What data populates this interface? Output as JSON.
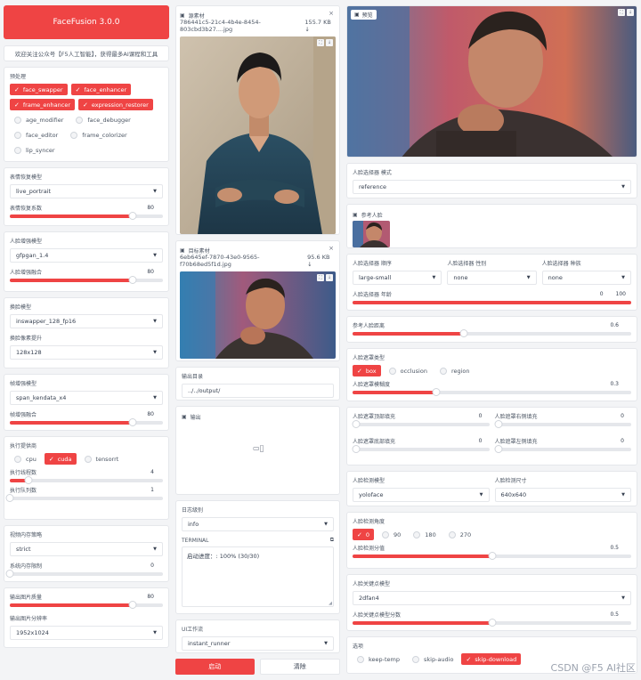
{
  "app_title": "FaceFusion 3.0.0",
  "promo": "欢迎关注公众号【F5人工智能】，获得最多AI课程和工具",
  "processors": {
    "label": "预处理",
    "items": [
      {
        "label": "face_swapper",
        "on": true
      },
      {
        "label": "face_enhancer",
        "on": true
      },
      {
        "label": "frame_enhancer",
        "on": true
      },
      {
        "label": "expression_restorer",
        "on": true
      },
      {
        "label": "age_modifier",
        "on": false
      },
      {
        "label": "face_debugger",
        "on": false
      },
      {
        "label": "face_editor",
        "on": false
      },
      {
        "label": "frame_colorizer",
        "on": false
      },
      {
        "label": "lip_syncer",
        "on": false
      }
    ]
  },
  "expression": {
    "model_label": "表情恢复模型",
    "model_value": "live_portrait",
    "factor_label": "表情恢复系数",
    "factor_value": "80",
    "factor_level": 0.8
  },
  "face_enhancer": {
    "model_label": "人脸增强模型",
    "model_value": "gfpgan_1.4",
    "blend_label": "人脸增强融合",
    "blend_value": "80",
    "blend_level": 0.8
  },
  "face_swapper": {
    "model_label": "换脸模型",
    "model_value": "inswapper_128_fp16",
    "pixel_label": "换脸像素提升",
    "pixel_value": "128x128"
  },
  "frame_enhancer": {
    "model_label": "帧增强模型",
    "model_value": "span_kendata_x4",
    "blend_label": "帧增强融合",
    "blend_value": "80",
    "blend_level": 0.8
  },
  "execution": {
    "providers_label": "执行提供商",
    "providers": [
      {
        "label": "cpu",
        "on": false
      },
      {
        "label": "cuda",
        "on": true
      },
      {
        "label": "tensorrt",
        "on": false
      }
    ],
    "threads_label": "执行线程数",
    "threads_value": "4",
    "threads_level": 0.12,
    "queue_label": "执行队列数",
    "queue_value": "1",
    "queue_level": 0.0
  },
  "memory": {
    "strategy_label": "视频内存策略",
    "strategy_value": "strict",
    "limit_label": "系统内存限制",
    "limit_value": "0",
    "limit_level": 0.0
  },
  "output_image": {
    "quality_label": "输出图片质量",
    "quality_value": "80",
    "quality_level": 0.8,
    "res_label": "输出图片分辨率",
    "res_value": "1952x1024"
  },
  "source": {
    "title": "源素材",
    "filename": "786441c5-21c4-4b4e-8454-803cbd3b27....jpg",
    "size": "155.7 KB ↓"
  },
  "target": {
    "title": "目标素材",
    "filename": "6eb645ef-7870-43e0-9565-f70b68ed5f1d.jpg",
    "size": "95.6 KB ↓"
  },
  "output_dir": {
    "label": "输出目录",
    "value": "../../output/"
  },
  "output": {
    "label": "输出"
  },
  "log": {
    "label": "日志级别",
    "value": "info",
    "terminal_label": "TERMINAL",
    "terminal_text": "启动进度：: 100% (30/30)"
  },
  "ui_workflow": {
    "label": "UI工作流",
    "value": "instant_runner"
  },
  "actions": {
    "start": "启动",
    "clear": "清除"
  },
  "preview": {
    "title": "预览"
  },
  "face_selector": {
    "mode_label": "人脸选择器 模式",
    "mode_value": "reference",
    "ref_label": "参考人脸"
  },
  "selector_params": {
    "order_label": "人脸选择器 顺序",
    "order_value": "large-small",
    "gender_label": "人脸选择器 性别",
    "gender_value": "none",
    "race_label": "人脸选择器 种族",
    "race_value": "none",
    "age_label": "人脸选择器 年龄",
    "age_min": "0",
    "age_max": "100"
  },
  "ref_distance": {
    "label": "参考人脸距离",
    "value": "0.6",
    "level": 0.4
  },
  "mask": {
    "types_label": "人脸遮罩类型",
    "types": [
      {
        "label": "box",
        "on": true
      },
      {
        "label": "occlusion",
        "on": false
      },
      {
        "label": "region",
        "on": false
      }
    ],
    "blur_label": "人脸遮罩模糊度",
    "blur_value": "0.3",
    "blur_level": 0.3
  },
  "padding": {
    "top_label": "人脸遮罩顶部填充",
    "top_value": "0",
    "right_label": "人脸遮罩右侧填充",
    "right_value": "0",
    "bottom_label": "人脸遮罩底部填充",
    "bottom_value": "0",
    "left_label": "人脸遮罩左侧填充",
    "left_value": "0"
  },
  "detector": {
    "model_label": "人脸检测模型",
    "model_value": "yoloface",
    "size_label": "人脸检测尺寸",
    "size_value": "640x640"
  },
  "detector_angle": {
    "label": "人脸检测角度",
    "angles": [
      {
        "label": "0",
        "on": true
      },
      {
        "label": "90",
        "on": false
      },
      {
        "label": "180",
        "on": false
      },
      {
        "label": "270",
        "on": false
      }
    ],
    "score_label": "人脸检测分值",
    "score_value": "0.5",
    "score_level": 0.5
  },
  "landmarker": {
    "model_label": "人脸关键点模型",
    "model_value": "2dfan4",
    "score_label": "人脸关键点模型分数",
    "score_value": "0.5",
    "score_level": 0.5
  },
  "options": {
    "label": "选项",
    "items": [
      {
        "label": "keep-temp",
        "on": false
      },
      {
        "label": "skip-audio",
        "on": false
      },
      {
        "label": "skip-download",
        "on": true
      }
    ]
  },
  "watermark": "CSDN @F5 AI社区",
  "colors": {
    "accent": "#ef4444",
    "bg": "#f3f4f6"
  }
}
